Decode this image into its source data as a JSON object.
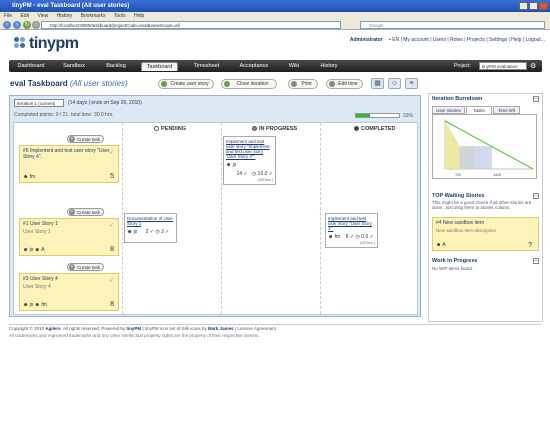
{
  "window": {
    "title": "tinyPM - eval Taskboard (All user stories)"
  },
  "browser": {
    "menu": [
      "File",
      "Edit",
      "View",
      "History",
      "Bookmarks",
      "Tools",
      "Help"
    ],
    "url": "http://localhost:8080/taskboard/projectCode=eval&viewScope=all",
    "search_placeholder": "Google"
  },
  "header": {
    "logo": "tinypm",
    "user": "Administrator",
    "lang": "EN",
    "links": "| My account | Users | Roles | Projects | Settings | Help | Logout..."
  },
  "nav": {
    "tabs": [
      "Dashboard",
      "Sandbox",
      "Backlog",
      "Taskboard",
      "Timesheet",
      "Acceptance",
      "Wiki",
      "History"
    ],
    "active_tab": "Taskboard",
    "project_label": "Project:",
    "project_value": "tinyPM evaluation"
  },
  "taskboard": {
    "title": "eval Taskboard",
    "scope": "(All user stories)",
    "buttons": {
      "create_story": "Create user story",
      "close_iteration": "Close iteration",
      "print": "Print",
      "edit_time": "Edit time"
    },
    "iteration_select": "Iteration 1 (current)",
    "iteration_info": "(14 days | ends on Sep 20, 2010)",
    "completed_line": "Completed points: 0 / 21. total time: 30.0 hrs.",
    "progress": {
      "percent": 33,
      "label": "33%"
    },
    "columns": {
      "pending": "PENDING",
      "in_progress": "IN PROGRESS",
      "completed": "COMPLETED"
    },
    "create_task_label": "Create task",
    "stories": [
      {
        "title": "#5 Implement and test user story \"User Story 4\".",
        "desc": "",
        "user": "fm",
        "points": "5"
      },
      {
        "title": "#1 User Story 1",
        "desc": "User Story 1",
        "user": "js",
        "user2": "A",
        "points": "8"
      },
      {
        "title": "#3 User Story 4",
        "desc": "User Story 4",
        "user": "js",
        "user2": "fm",
        "points": "8"
      }
    ],
    "tasks": {
      "inprogress1": {
        "title": "Implement and test user story \"Implement and test user story 'User Story 4'\".",
        "user": "js",
        "hours": "14",
        "effort": "10.0",
        "effort_note": "(30 hrs.)"
      },
      "pending1": {
        "title": "Documentation of User Story 1",
        "user": "js",
        "a": "2",
        "b": "3"
      },
      "completed1": {
        "title": "Implement and test user story \"User Story 1\".",
        "user": "fm",
        "a": "8",
        "b": "0.0",
        "effort_note": "(20 hrs.)"
      }
    }
  },
  "sidebar": {
    "burndown_title": "Iteration Burndown",
    "burndown_tabs": [
      "User Stories",
      "Tasks",
      "Time left"
    ],
    "burndown_selected": "Tasks",
    "burndown_xlabels": [
      "7/8",
      "14/8"
    ],
    "top_waiting_title": "TOP Waiting Stories",
    "top_waiting_desc": "This might be a good choice if all other stories are done. Just drag them to stories column.",
    "top_story": {
      "title": "#4 New sandbox item",
      "desc": "New sandbox item description",
      "user": "A",
      "points": "?"
    },
    "wip_title": "Work in Progress",
    "wip_text": "No WIP items found."
  },
  "footer": {
    "line1_a": "Copyright © 2010",
    "line1_brand": "Agilers",
    "line1_b": ". All rights reserved. Powered by",
    "line1_product": "tinyPM",
    "line1_c": "| tinyPM icon set of Silk icons by",
    "line1_author": "Mark James",
    "line1_d": "| License Agreement",
    "line2": "All trademarks and registered trademarks and any other intellectual property rights are the property of their respective owners."
  },
  "chart_data": {
    "type": "line",
    "x_labels": [
      "7/8",
      "14/8"
    ],
    "series": [
      {
        "values": [
          21,
          0
        ]
      },
      {
        "values": [
          21,
          10,
          10
        ]
      }
    ]
  }
}
